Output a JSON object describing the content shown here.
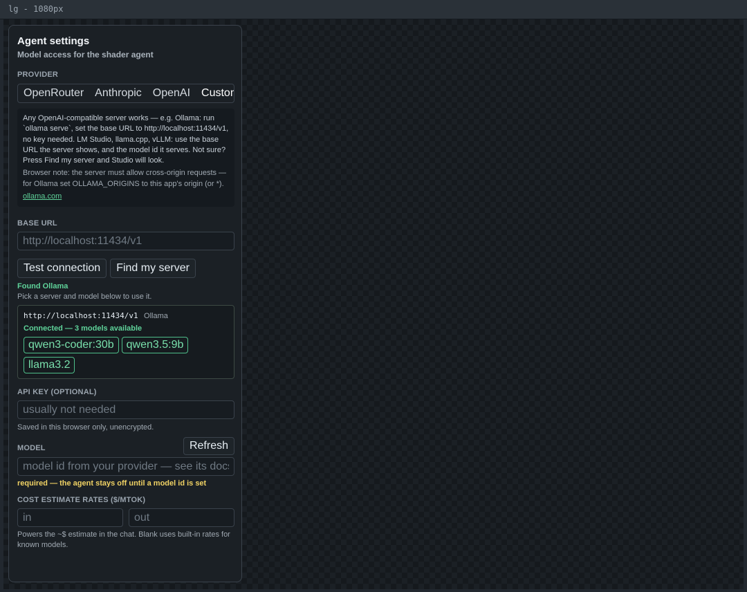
{
  "window": {
    "title": "lg - 1080px"
  },
  "panel": {
    "title": "Agent settings",
    "subtitle": "Model access for the shader agent"
  },
  "provider": {
    "label": "PROVIDER",
    "tabs": [
      "OpenRouter",
      "Anthropic",
      "OpenAI",
      "Custom"
    ],
    "selected": "Custom"
  },
  "info": {
    "text": "Any OpenAI-compatible server works — e.g. Ollama: run `ollama serve`, set the base URL to http://localhost:11434/v1, no key needed. LM Studio, llama.cpp, vLLM: use the base URL the server shows, and the model id it serves. Not sure? Press Find my server and Studio will look.",
    "note": "Browser note: the server must allow cross-origin requests — for Ollama set OLLAMA_ORIGINS to this app's origin (or *).",
    "link": "ollama.com"
  },
  "base_url": {
    "label": "BASE URL",
    "placeholder": "http://localhost:11434/v1",
    "value": ""
  },
  "actions": {
    "test_connection": "Test connection",
    "find_server": "Find my server"
  },
  "discovery": {
    "found": "Found Ollama",
    "hint": "Pick a server and model below to use it.",
    "server_url": "http://localhost:11434/v1",
    "server_name": "Ollama",
    "status": "Connected — 3 models available",
    "models": [
      "qwen3-coder:30b",
      "qwen3.5:9b",
      "llama3.2"
    ]
  },
  "api_key": {
    "label": "API KEY (OPTIONAL)",
    "placeholder": "usually not needed",
    "help": "Saved in this browser only, unencrypted."
  },
  "model": {
    "label": "MODEL",
    "refresh": "Refresh",
    "placeholder": "model id from your provider — see its docs",
    "warning": "required — the agent stays off until a model id is set"
  },
  "cost": {
    "label": "COST ESTIMATE RATES ($/MTOK)",
    "in_placeholder": "in",
    "out_placeholder": "out",
    "help": "Powers the ~$ estimate in the chat. Blank uses built-in rates for known models."
  },
  "colors": {
    "accent_green": "#5fd39a",
    "warning_yellow": "#f0d264",
    "panel_bg": "#1b2025"
  }
}
